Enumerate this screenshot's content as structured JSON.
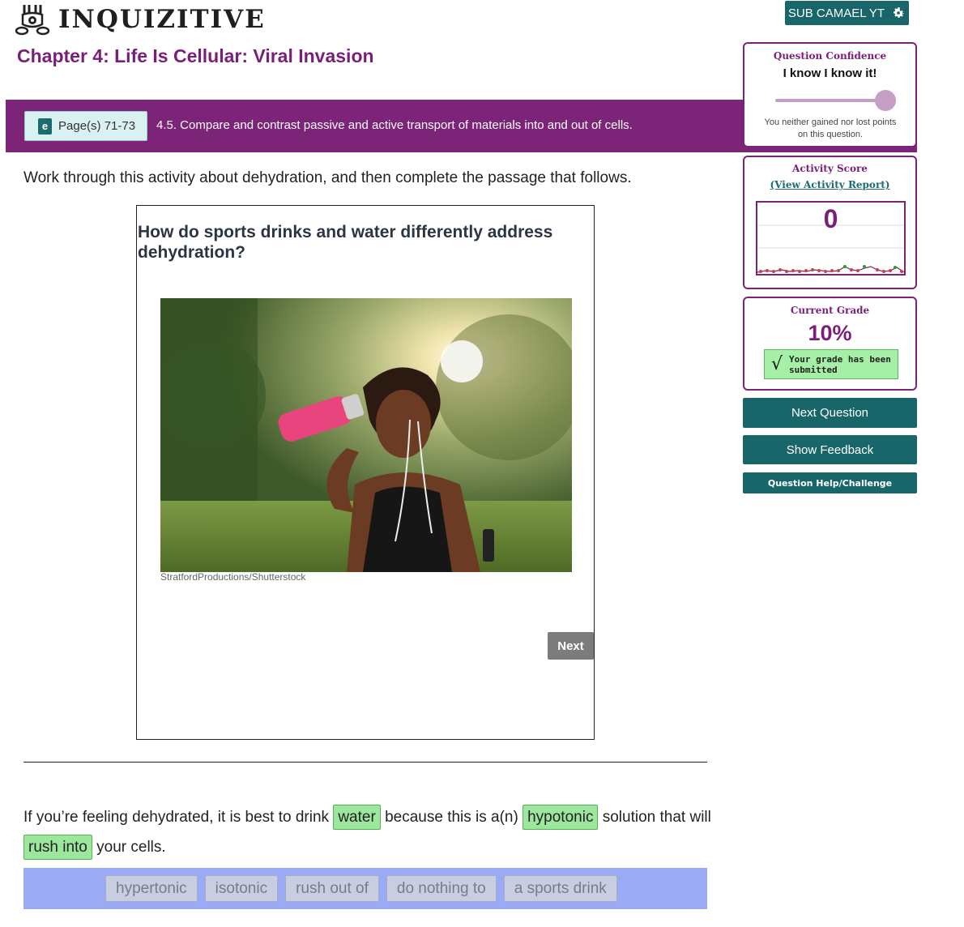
{
  "header": {
    "app_name": "INQUIZITIVE",
    "user_label": "SUB CAMAEL YT",
    "chapter_title": "Chapter 4: Life Is Cellular: Viral Invasion"
  },
  "objective_bar": {
    "page_ref": "Page(s) 71-73",
    "ebook_icon_letter": "e",
    "objective": "4.5. Compare and contrast passive and active transport of materials into and out of cells."
  },
  "main": {
    "instructions": "Work through this activity about dehydration, and then complete the passage that follows.",
    "activity": {
      "title": "How do sports drinks and water differently address dehydration?",
      "photo_credit": "StratfordProductions/Shutterstock",
      "next_label": "Next"
    },
    "passage": {
      "part1": "If you’re feeling dehydrated, it is best to drink ",
      "blank1": "water",
      "part2": " because this is a(n) ",
      "blank2": "hypotonic",
      "part3": " solution that will ",
      "blank3": "rush into",
      "part4": " your cells."
    },
    "word_bank": [
      "hypertonic",
      "isotonic",
      "rush out of",
      "do nothing to",
      "a sports drink"
    ]
  },
  "sidebar": {
    "confidence": {
      "title": "Question Confidence",
      "value": "I know I know it!",
      "note": "You neither gained nor lost points on this question.",
      "slider_level": 1.0
    },
    "activity_score": {
      "title": "Activity Score",
      "link": "(View Activity Report)",
      "value": "0"
    },
    "grade": {
      "title": "Current Grade",
      "value": "10%",
      "submitted_text": "Your grade has been submitted",
      "check_glyph": "√"
    },
    "buttons": {
      "next_question": "Next Question",
      "show_feedback": "Show Feedback",
      "help": "Question Help/Challenge"
    }
  },
  "colors": {
    "brand_purple": "#7b2478",
    "teal": "#18666a",
    "correct_green": "#9de69d",
    "word_bank_blue": "#9aaaf5"
  }
}
